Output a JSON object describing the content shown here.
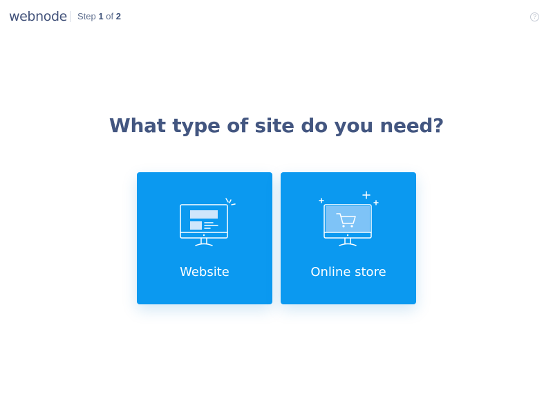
{
  "header": {
    "logo_text": "webnode",
    "step_prefix": "Step",
    "step_current": "1",
    "step_of": "of",
    "step_total": "2",
    "help_symbol": "?"
  },
  "main": {
    "title": "What type of site do you need?",
    "options": [
      {
        "label": "Website",
        "icon": "monitor-website-icon"
      },
      {
        "label": "Online store",
        "icon": "monitor-shopping-cart-icon"
      }
    ]
  },
  "colors": {
    "card": "#0b99f0",
    "title": "#435680",
    "label": "#ffffff"
  }
}
